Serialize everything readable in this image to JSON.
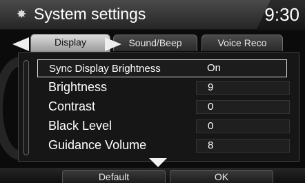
{
  "header": {
    "title": "System settings",
    "time": "9:30"
  },
  "tabs": [
    {
      "label": "Display"
    },
    {
      "label": "Sound/Beep"
    },
    {
      "label": "Voice Reco"
    }
  ],
  "settings": [
    {
      "label": "Sync Display Brightness",
      "value": "On"
    },
    {
      "label": "Brightness",
      "value": "9"
    },
    {
      "label": "Contrast",
      "value": "0"
    },
    {
      "label": "Black Level",
      "value": "0"
    },
    {
      "label": "Guidance Volume",
      "value": "8"
    }
  ],
  "footer": {
    "default_label": "Default",
    "ok_label": "OK"
  },
  "icons": {
    "title": "gear-icon",
    "prev": "arrow-left-icon",
    "next": "arrow-right-icon",
    "scroll": "arrow-down-icon"
  }
}
